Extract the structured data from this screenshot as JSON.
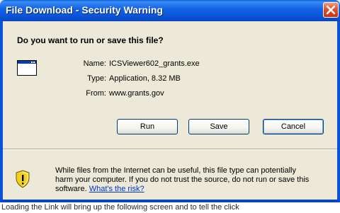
{
  "window": {
    "title": "File Download - Security Warning",
    "close_icon": "close-icon"
  },
  "question": "Do you want to run or save this file?",
  "file_info": {
    "name_label": "Name:",
    "name_value": "ICSViewer602_grants.exe",
    "type_label": "Type:",
    "type_value": "Application, 8.32 MB",
    "from_label": "From:",
    "from_value": "www.grants.gov"
  },
  "buttons": {
    "run_label": "Run",
    "save_label": "Save",
    "cancel_label": "Cancel"
  },
  "warning": {
    "line1": "While files from the Internet can be useful, this file type can potentially",
    "line2": "harm your computer. If you do not trust the source, do not run or save this",
    "line3_prefix": "software.",
    "link_text": "What's the risk?"
  },
  "background_text": "Loading the Link will bring up the following screen and to tell the click"
}
